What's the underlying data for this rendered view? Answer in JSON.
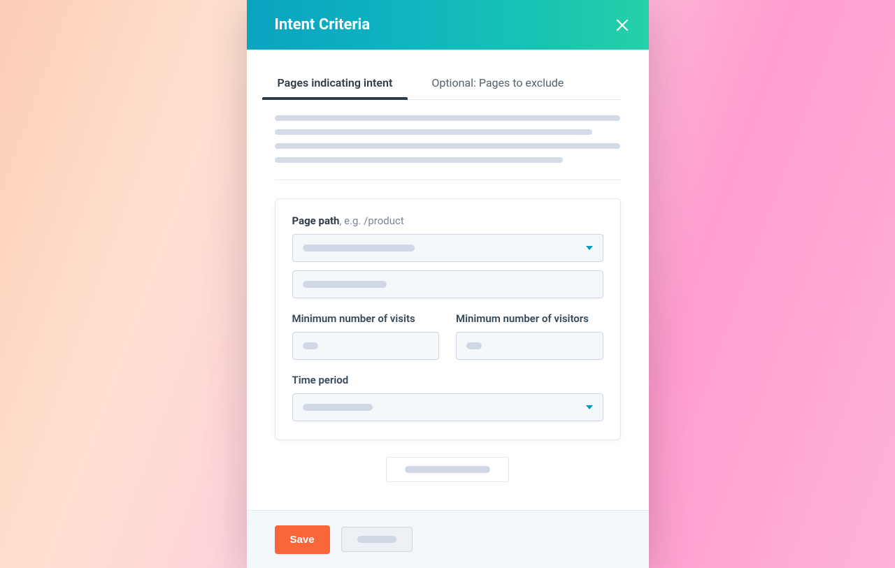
{
  "header": {
    "title": "Intent Criteria"
  },
  "tabs": [
    {
      "label": "Pages indicating intent",
      "active": true
    },
    {
      "label": "Optional: Pages to exclude",
      "active": false
    }
  ],
  "form": {
    "page_path_label_bold": "Page path",
    "page_path_label_hint": ", e.g. /product",
    "min_visits_label": "Minimum number of visits",
    "min_visitors_label": "Minimum number of visitors",
    "time_period_label": "Time period"
  },
  "footer": {
    "save_label": "Save"
  }
}
